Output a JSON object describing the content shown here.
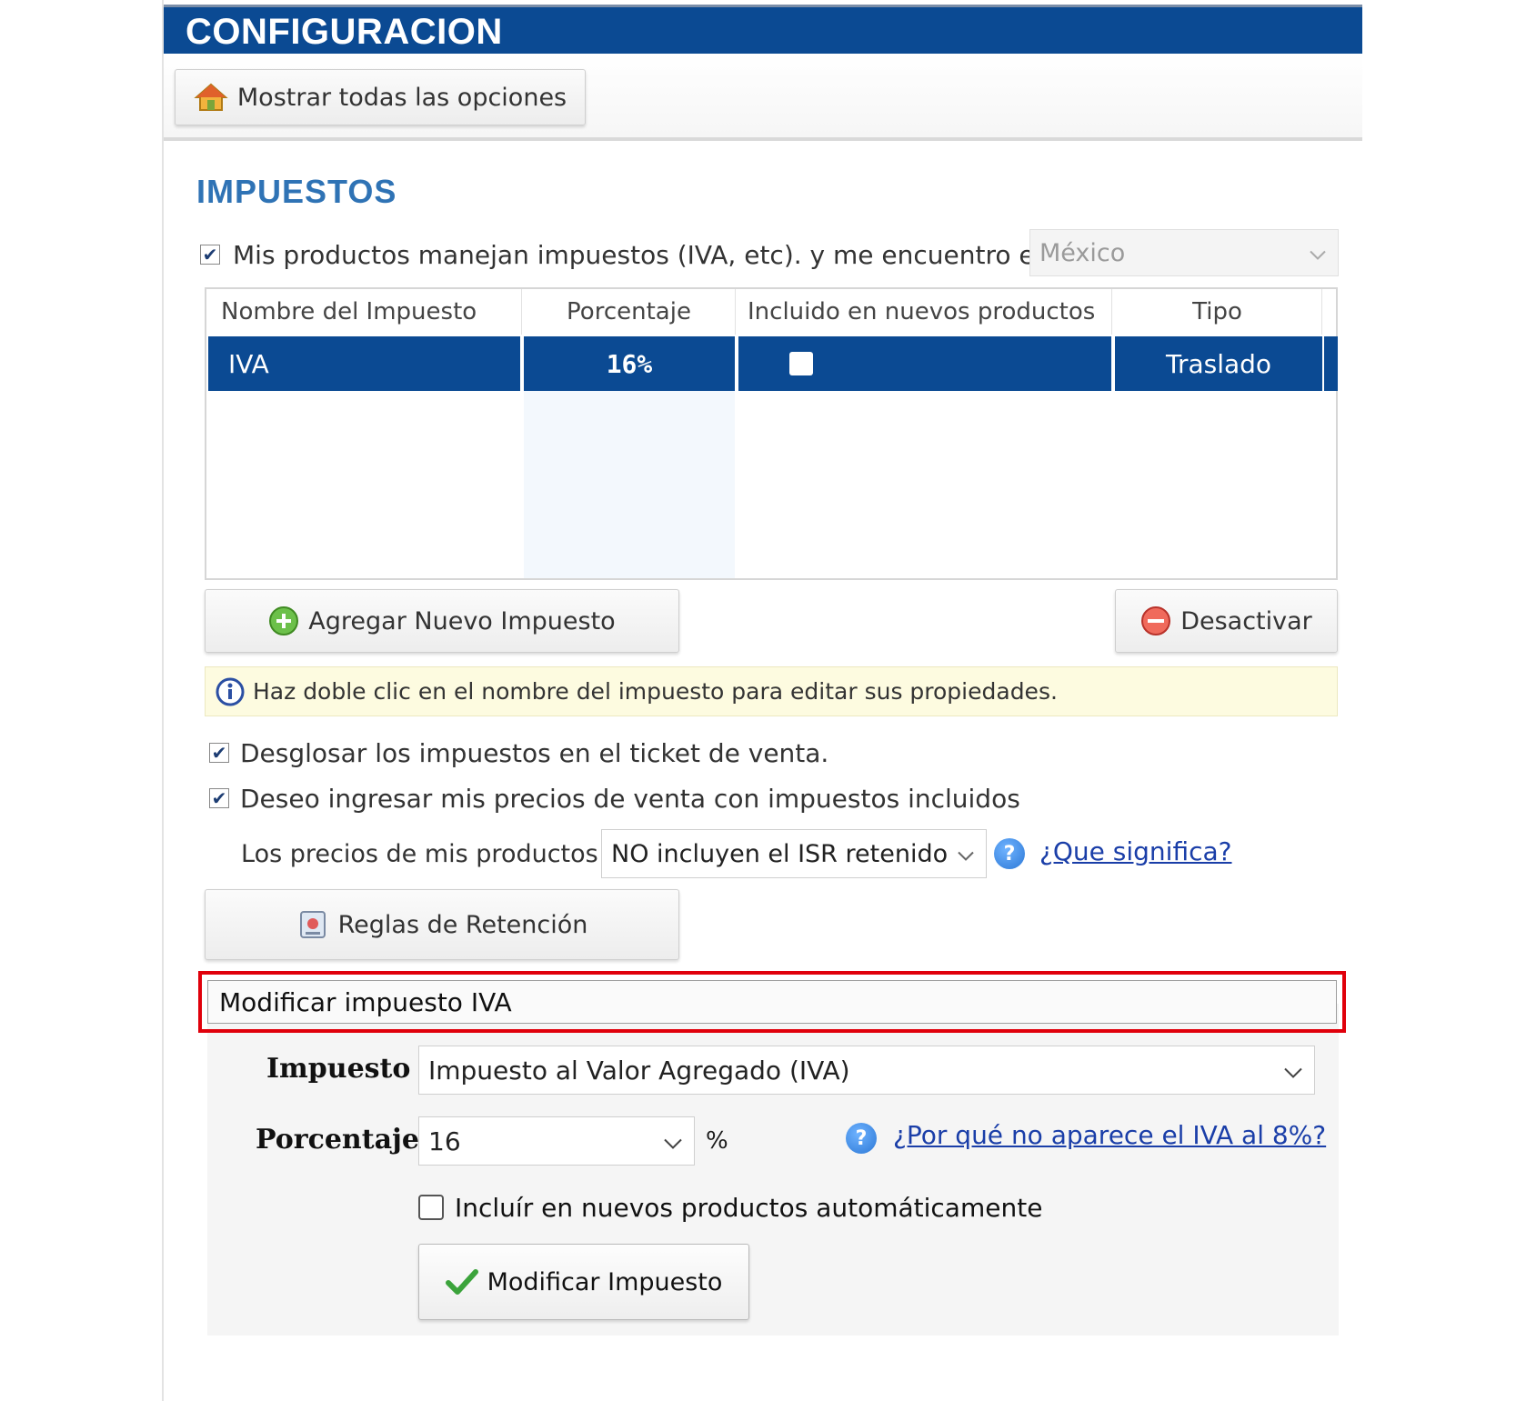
{
  "window": {
    "title": "CONFIGURACION"
  },
  "toolbar": {
    "show_all_label": "Mostrar todas las opciones"
  },
  "section": {
    "title": "IMPUESTOS"
  },
  "taxes_toggle": {
    "checked": true,
    "label": "Mis productos manejan impuestos (IVA, etc). y me encuentro en:",
    "country": "México"
  },
  "grid": {
    "headers": [
      "Nombre del Impuesto",
      "Porcentaje",
      "Incluido en nuevos productos",
      "Tipo"
    ],
    "rows": [
      {
        "name": "IVA",
        "percent": "16%",
        "included": false,
        "type": "Traslado"
      }
    ]
  },
  "buttons": {
    "add_tax": "Agregar Nuevo Impuesto",
    "deactivate": "Desactivar",
    "retention_rules": "Reglas de Retención",
    "modify_tax": "Modificar Impuesto"
  },
  "info": {
    "text": "Haz doble clic en el nombre del impuesto para editar sus propiedades."
  },
  "options": {
    "breakdown_label": "Desglosar los impuestos en el ticket de venta.",
    "breakdown_checked": true,
    "prices_include_label": "Deseo ingresar mis precios de venta con impuestos incluidos",
    "prices_include_checked": true
  },
  "isr": {
    "label": "Los precios de mis productos",
    "selected": "NO incluyen el ISR retenido",
    "help_link": "¿Que significa?"
  },
  "edit": {
    "title_value": "Modificar impuesto IVA",
    "tax_label": "Impuesto",
    "tax_selected": "Impuesto al Valor Agregado (IVA)",
    "percent_label": "Porcentaje",
    "percent_selected": "16",
    "percent_unit": "%",
    "help_link": "¿Por qué no aparece el IVA al 8%?",
    "auto_include_label": "Incluír en nuevos productos automáticamente",
    "auto_include_checked": false
  },
  "colors": {
    "title_bar": "#0b4a93",
    "section_title": "#2f73b5",
    "highlight": "#e0000b",
    "link": "#1a3ea8"
  }
}
